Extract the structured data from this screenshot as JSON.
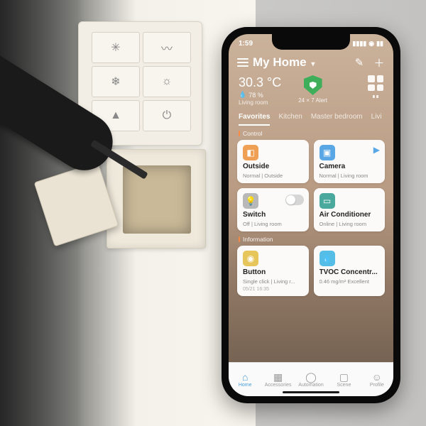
{
  "status_bar": {
    "time": "1:59",
    "am_indicator": "◂"
  },
  "header": {
    "title": "My Home"
  },
  "summary": {
    "temperature": "30.3 °C",
    "humidity": "78 %",
    "location": "Living room",
    "alert_label": "24 × 7 Alert",
    "grid_label": "∎∎"
  },
  "tabs": [
    "Favorites",
    "Kitchen",
    "Master bedroom",
    "Livi"
  ],
  "sections": {
    "control": "Control",
    "information": "Information"
  },
  "cards": {
    "outside": {
      "title": "Outside",
      "sub": "Normal | Outside"
    },
    "camera": {
      "title": "Camera",
      "sub": "Normal | Living room"
    },
    "switch": {
      "title": "Switch",
      "sub": "Off | Living room"
    },
    "ac": {
      "title": "Air Conditioner",
      "sub": "Online | Living room"
    },
    "button": {
      "title": "Button",
      "sub": "Single click | Living r...",
      "time": "05/21 16:35"
    },
    "tvoc": {
      "title": "TVOC Concentr...",
      "sub": "0.46 mg/m² Excellent",
      "time": ""
    }
  },
  "tabbar": {
    "home": "Home",
    "accessories": "Accessories",
    "automation": "Automation",
    "scene": "Scene",
    "profile": "Profile"
  }
}
